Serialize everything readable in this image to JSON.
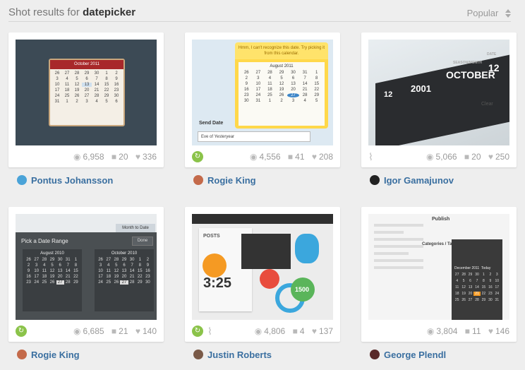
{
  "header": {
    "prefix": "Shot results for",
    "query": "datepicker",
    "sort_label": "Popular"
  },
  "shots": [
    {
      "views": "6,958",
      "comments": "20",
      "likes": "336",
      "player": "Pontus Johansson",
      "rebound": false,
      "attachment": false,
      "thumb": {
        "month": "October 2011"
      }
    },
    {
      "views": "4,556",
      "comments": "41",
      "likes": "208",
      "player": "Rogie King",
      "rebound": true,
      "attachment": false,
      "thumb": {
        "tip": "Hmm, I can't recognize this date. Try picking it from this calendar.",
        "month": "August 2011",
        "label": "Send Date",
        "value": "Eve of Yesteryear"
      }
    },
    {
      "views": "5,066",
      "comments": "20",
      "likes": "250",
      "player": "Igor Gamajunov",
      "rebound": false,
      "attachment": true,
      "thumb": {
        "year": "2001",
        "month_label": "SEASON/MONTH",
        "month": "OCTOBER",
        "date": "DATE",
        "day": "12",
        "num1": "12",
        "clear": "Clear"
      }
    },
    {
      "views": "6,685",
      "comments": "21",
      "likes": "140",
      "player": "Rogie King",
      "rebound": true,
      "attachment": false,
      "thumb": {
        "range": "Month to Date",
        "title": "Pick a Date Range",
        "done": "Done",
        "month_a": "August 2010",
        "month_b": "October 2010"
      }
    },
    {
      "views": "4,806",
      "comments": "4",
      "likes": "137",
      "player": "Justin Roberts",
      "rebound": true,
      "attachment": true,
      "thumb": {
        "posts": "POSTS",
        "time": "3:25",
        "stat": "1500"
      }
    },
    {
      "views": "3,804",
      "comments": "11",
      "likes": "146",
      "player": "George Plendl",
      "rebound": false,
      "attachment": false,
      "thumb": {
        "publish": "Publish",
        "categories": "Categories / Tags",
        "month": "December 2011",
        "today": "Today"
      }
    }
  ]
}
